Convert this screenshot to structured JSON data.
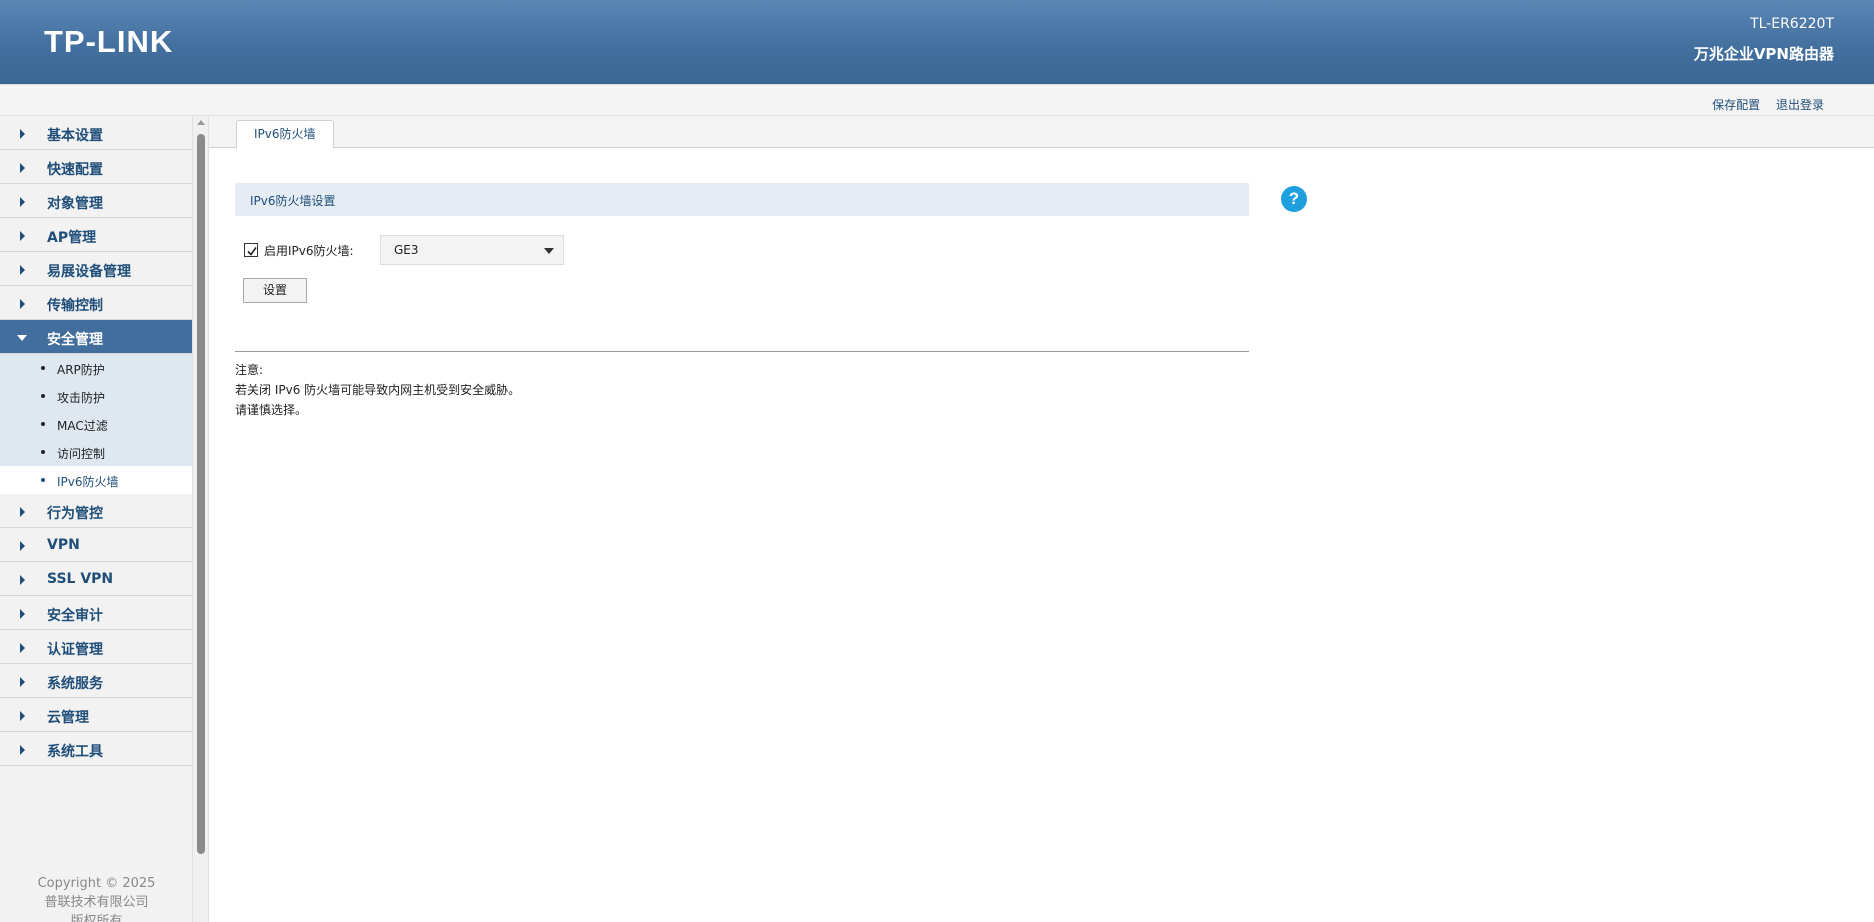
{
  "header": {
    "logo": "TP-LINK",
    "model": "TL-ER6220T",
    "product": "万兆企业VPN路由器"
  },
  "toplinks": {
    "save": "保存配置",
    "logout": "退出登录"
  },
  "sidebar": {
    "items": [
      {
        "label": "基本设置"
      },
      {
        "label": "快速配置"
      },
      {
        "label": "对象管理"
      },
      {
        "label": "AP管理"
      },
      {
        "label": "易展设备管理"
      },
      {
        "label": "传输控制"
      }
    ],
    "active": {
      "label": "安全管理",
      "sub": [
        {
          "label": "ARP防护"
        },
        {
          "label": "攻击防护"
        },
        {
          "label": "MAC过滤"
        },
        {
          "label": "访问控制"
        },
        {
          "label": "IPv6防火墙"
        }
      ]
    },
    "items_after": [
      {
        "label": "行为管控"
      },
      {
        "label": "VPN"
      },
      {
        "label": "SSL VPN"
      },
      {
        "label": "安全审计"
      },
      {
        "label": "认证管理"
      },
      {
        "label": "系统服务"
      },
      {
        "label": "云管理"
      },
      {
        "label": "系统工具"
      }
    ],
    "copyright": [
      "Copyright © 2025",
      "普联技术有限公司",
      "版权所有"
    ]
  },
  "tabs": [
    {
      "label": "IPv6防火墙"
    }
  ],
  "panel": {
    "title": "IPv6防火墙设置",
    "help_icon": "?",
    "enable_label": "启用IPv6防火墙:",
    "enable_checked": true,
    "interface_value": "GE3",
    "set_button": "设置"
  },
  "notes": {
    "title": "注意:",
    "lines": [
      "若关闭 IPv6 防火墙可能导致内网主机受到安全威胁。",
      "请谨慎选择。"
    ]
  },
  "colors": {
    "header": "#43709f",
    "menu_text": "#1f4e79",
    "active_menu": "#416e9d",
    "help": "#1ea0df"
  }
}
